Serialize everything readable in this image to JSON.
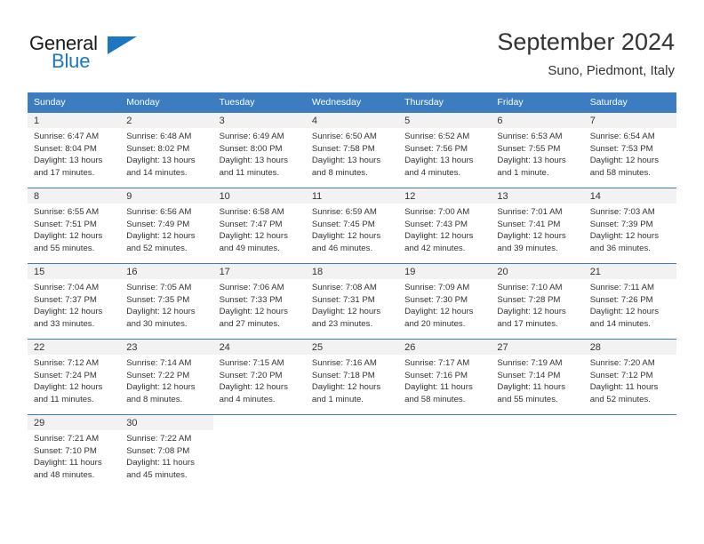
{
  "brand": {
    "name_part1": "General",
    "name_part2": "Blue",
    "accent_color": "#1c77c3"
  },
  "header": {
    "title": "September 2024",
    "subtitle": "Suno, Piedmont, Italy"
  },
  "calendar": {
    "header_color": "#3b7dc0",
    "weekday_headers": [
      "Sunday",
      "Monday",
      "Tuesday",
      "Wednesday",
      "Thursday",
      "Friday",
      "Saturday"
    ],
    "weeks": [
      [
        {
          "day": "1",
          "sunrise": "Sunrise: 6:47 AM",
          "sunset": "Sunset: 8:04 PM",
          "daylight_line1": "Daylight: 13 hours",
          "daylight_line2": "and 17 minutes."
        },
        {
          "day": "2",
          "sunrise": "Sunrise: 6:48 AM",
          "sunset": "Sunset: 8:02 PM",
          "daylight_line1": "Daylight: 13 hours",
          "daylight_line2": "and 14 minutes."
        },
        {
          "day": "3",
          "sunrise": "Sunrise: 6:49 AM",
          "sunset": "Sunset: 8:00 PM",
          "daylight_line1": "Daylight: 13 hours",
          "daylight_line2": "and 11 minutes."
        },
        {
          "day": "4",
          "sunrise": "Sunrise: 6:50 AM",
          "sunset": "Sunset: 7:58 PM",
          "daylight_line1": "Daylight: 13 hours",
          "daylight_line2": "and 8 minutes."
        },
        {
          "day": "5",
          "sunrise": "Sunrise: 6:52 AM",
          "sunset": "Sunset: 7:56 PM",
          "daylight_line1": "Daylight: 13 hours",
          "daylight_line2": "and 4 minutes."
        },
        {
          "day": "6",
          "sunrise": "Sunrise: 6:53 AM",
          "sunset": "Sunset: 7:55 PM",
          "daylight_line1": "Daylight: 13 hours",
          "daylight_line2": "and 1 minute."
        },
        {
          "day": "7",
          "sunrise": "Sunrise: 6:54 AM",
          "sunset": "Sunset: 7:53 PM",
          "daylight_line1": "Daylight: 12 hours",
          "daylight_line2": "and 58 minutes."
        }
      ],
      [
        {
          "day": "8",
          "sunrise": "Sunrise: 6:55 AM",
          "sunset": "Sunset: 7:51 PM",
          "daylight_line1": "Daylight: 12 hours",
          "daylight_line2": "and 55 minutes."
        },
        {
          "day": "9",
          "sunrise": "Sunrise: 6:56 AM",
          "sunset": "Sunset: 7:49 PM",
          "daylight_line1": "Daylight: 12 hours",
          "daylight_line2": "and 52 minutes."
        },
        {
          "day": "10",
          "sunrise": "Sunrise: 6:58 AM",
          "sunset": "Sunset: 7:47 PM",
          "daylight_line1": "Daylight: 12 hours",
          "daylight_line2": "and 49 minutes."
        },
        {
          "day": "11",
          "sunrise": "Sunrise: 6:59 AM",
          "sunset": "Sunset: 7:45 PM",
          "daylight_line1": "Daylight: 12 hours",
          "daylight_line2": "and 46 minutes."
        },
        {
          "day": "12",
          "sunrise": "Sunrise: 7:00 AM",
          "sunset": "Sunset: 7:43 PM",
          "daylight_line1": "Daylight: 12 hours",
          "daylight_line2": "and 42 minutes."
        },
        {
          "day": "13",
          "sunrise": "Sunrise: 7:01 AM",
          "sunset": "Sunset: 7:41 PM",
          "daylight_line1": "Daylight: 12 hours",
          "daylight_line2": "and 39 minutes."
        },
        {
          "day": "14",
          "sunrise": "Sunrise: 7:03 AM",
          "sunset": "Sunset: 7:39 PM",
          "daylight_line1": "Daylight: 12 hours",
          "daylight_line2": "and 36 minutes."
        }
      ],
      [
        {
          "day": "15",
          "sunrise": "Sunrise: 7:04 AM",
          "sunset": "Sunset: 7:37 PM",
          "daylight_line1": "Daylight: 12 hours",
          "daylight_line2": "and 33 minutes."
        },
        {
          "day": "16",
          "sunrise": "Sunrise: 7:05 AM",
          "sunset": "Sunset: 7:35 PM",
          "daylight_line1": "Daylight: 12 hours",
          "daylight_line2": "and 30 minutes."
        },
        {
          "day": "17",
          "sunrise": "Sunrise: 7:06 AM",
          "sunset": "Sunset: 7:33 PM",
          "daylight_line1": "Daylight: 12 hours",
          "daylight_line2": "and 27 minutes."
        },
        {
          "day": "18",
          "sunrise": "Sunrise: 7:08 AM",
          "sunset": "Sunset: 7:31 PM",
          "daylight_line1": "Daylight: 12 hours",
          "daylight_line2": "and 23 minutes."
        },
        {
          "day": "19",
          "sunrise": "Sunrise: 7:09 AM",
          "sunset": "Sunset: 7:30 PM",
          "daylight_line1": "Daylight: 12 hours",
          "daylight_line2": "and 20 minutes."
        },
        {
          "day": "20",
          "sunrise": "Sunrise: 7:10 AM",
          "sunset": "Sunset: 7:28 PM",
          "daylight_line1": "Daylight: 12 hours",
          "daylight_line2": "and 17 minutes."
        },
        {
          "day": "21",
          "sunrise": "Sunrise: 7:11 AM",
          "sunset": "Sunset: 7:26 PM",
          "daylight_line1": "Daylight: 12 hours",
          "daylight_line2": "and 14 minutes."
        }
      ],
      [
        {
          "day": "22",
          "sunrise": "Sunrise: 7:12 AM",
          "sunset": "Sunset: 7:24 PM",
          "daylight_line1": "Daylight: 12 hours",
          "daylight_line2": "and 11 minutes."
        },
        {
          "day": "23",
          "sunrise": "Sunrise: 7:14 AM",
          "sunset": "Sunset: 7:22 PM",
          "daylight_line1": "Daylight: 12 hours",
          "daylight_line2": "and 8 minutes."
        },
        {
          "day": "24",
          "sunrise": "Sunrise: 7:15 AM",
          "sunset": "Sunset: 7:20 PM",
          "daylight_line1": "Daylight: 12 hours",
          "daylight_line2": "and 4 minutes."
        },
        {
          "day": "25",
          "sunrise": "Sunrise: 7:16 AM",
          "sunset": "Sunset: 7:18 PM",
          "daylight_line1": "Daylight: 12 hours",
          "daylight_line2": "and 1 minute."
        },
        {
          "day": "26",
          "sunrise": "Sunrise: 7:17 AM",
          "sunset": "Sunset: 7:16 PM",
          "daylight_line1": "Daylight: 11 hours",
          "daylight_line2": "and 58 minutes."
        },
        {
          "day": "27",
          "sunrise": "Sunrise: 7:19 AM",
          "sunset": "Sunset: 7:14 PM",
          "daylight_line1": "Daylight: 11 hours",
          "daylight_line2": "and 55 minutes."
        },
        {
          "day": "28",
          "sunrise": "Sunrise: 7:20 AM",
          "sunset": "Sunset: 7:12 PM",
          "daylight_line1": "Daylight: 11 hours",
          "daylight_line2": "and 52 minutes."
        }
      ],
      [
        {
          "day": "29",
          "sunrise": "Sunrise: 7:21 AM",
          "sunset": "Sunset: 7:10 PM",
          "daylight_line1": "Daylight: 11 hours",
          "daylight_line2": "and 48 minutes."
        },
        {
          "day": "30",
          "sunrise": "Sunrise: 7:22 AM",
          "sunset": "Sunset: 7:08 PM",
          "daylight_line1": "Daylight: 11 hours",
          "daylight_line2": "and 45 minutes."
        },
        {
          "day": "",
          "sunrise": "",
          "sunset": "",
          "daylight_line1": "",
          "daylight_line2": ""
        },
        {
          "day": "",
          "sunrise": "",
          "sunset": "",
          "daylight_line1": "",
          "daylight_line2": ""
        },
        {
          "day": "",
          "sunrise": "",
          "sunset": "",
          "daylight_line1": "",
          "daylight_line2": ""
        },
        {
          "day": "",
          "sunrise": "",
          "sunset": "",
          "daylight_line1": "",
          "daylight_line2": ""
        },
        {
          "day": "",
          "sunrise": "",
          "sunset": "",
          "daylight_line1": "",
          "daylight_line2": ""
        }
      ]
    ]
  }
}
